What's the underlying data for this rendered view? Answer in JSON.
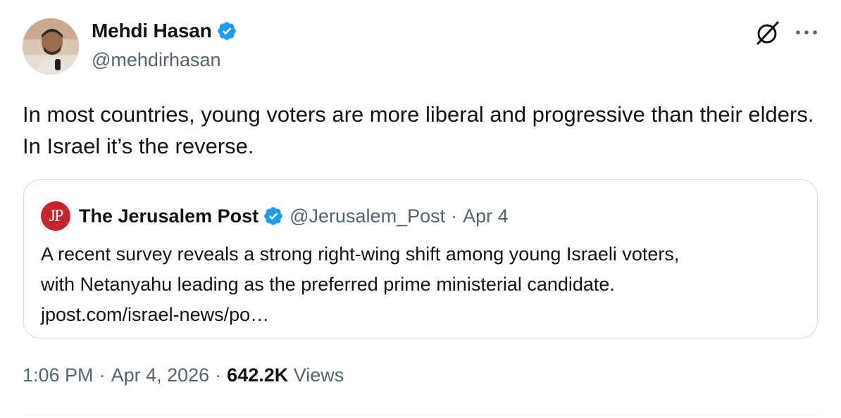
{
  "author": {
    "display_name": "Mehdi Hasan",
    "handle": "@mehdirhasan",
    "verified": true,
    "verified_color": "#1d9bf0"
  },
  "tweet": {
    "text": "In most countries, young voters are more liberal and progressive than their elders. In Israel it’s the reverse."
  },
  "quoted_tweet": {
    "avatar_initials": "JP",
    "avatar_color": "#c4262e",
    "display_name": "The Jerusalem Post",
    "verified": true,
    "handle": "@Jerusalem_Post",
    "separator": "·",
    "date": "Apr 4",
    "text_lines": [
      "A recent survey reveals a strong right-wing shift among young Israeli voters,",
      "with Netanyahu leading as the preferred prime ministerial candidate.",
      "jpost.com/israel-news/po…"
    ]
  },
  "meta": {
    "time": "1:06 PM",
    "separator": "·",
    "date": "Apr 4, 2026",
    "views_count": "642.2K",
    "views_label": "Views"
  },
  "icons": {
    "grok": "grok-icon",
    "more": "more-options-icon",
    "verified": "verified-badge-icon"
  }
}
